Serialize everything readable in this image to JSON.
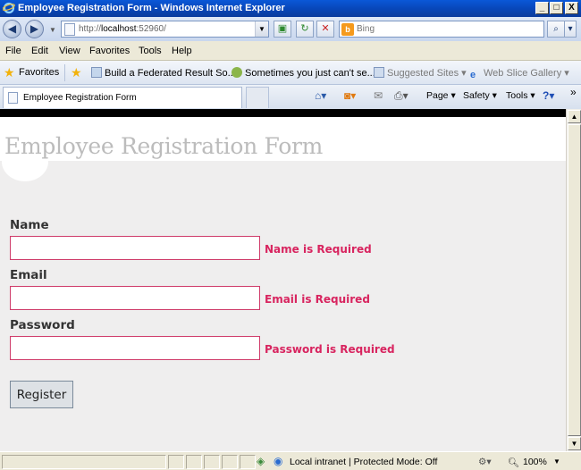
{
  "window": {
    "title": "Employee Registration Form - Windows Internet Explorer",
    "minimize": "_",
    "maximize": "□",
    "close": "X"
  },
  "address_bar": {
    "url_prefix": "http://",
    "url_host": "localhost",
    "url_suffix": ":52960/",
    "search_placeholder": "Bing"
  },
  "menu": [
    "File",
    "Edit",
    "View",
    "Favorites",
    "Tools",
    "Help"
  ],
  "favorites_bar": {
    "favorites_label": "Favorites",
    "items": [
      "Build a Federated Result So...",
      "Sometimes you just can't se...",
      "Suggested Sites ▾",
      "Web Slice Gallery ▾"
    ]
  },
  "tab": {
    "label": "Employee Registration Form"
  },
  "command_bar": [
    "Page ▾",
    "Safety ▾",
    "Tools ▾"
  ],
  "page": {
    "title": "Employee Registration Form",
    "fields": [
      {
        "label": "Name",
        "value": "",
        "error": "Name is Required"
      },
      {
        "label": "Email",
        "value": "",
        "error": "Email is Required"
      },
      {
        "label": "Password",
        "value": "",
        "error": "Password is Required"
      }
    ],
    "register_button": "Register"
  },
  "status_bar": {
    "zone": "Local intranet | Protected Mode: Off",
    "zoom": "100%"
  },
  "colors": {
    "error": "#d8245f",
    "title_gray": "#bcbcbc",
    "titlebar_blue": "#0844b4"
  }
}
